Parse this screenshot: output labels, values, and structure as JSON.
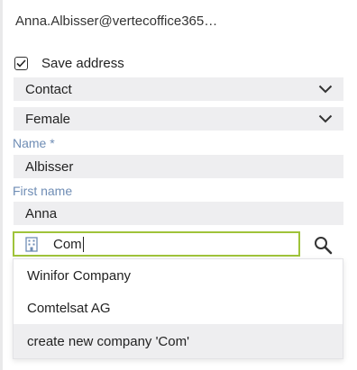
{
  "account": {
    "email": "Anna.Albisser@vertecoffice365…"
  },
  "save_address": {
    "label": "Save address",
    "checked": true
  },
  "type_select": {
    "value": "Contact",
    "icon": "chevron-down-icon"
  },
  "gender_select": {
    "value": "Female",
    "icon": "chevron-down-icon"
  },
  "name_field": {
    "label": "Name *",
    "value": "Albisser"
  },
  "first_name_field": {
    "label": "First name",
    "value": "Anna"
  },
  "company_field": {
    "value": "Com",
    "icon": "building-icon",
    "search_icon": "search-icon",
    "focus_color": "#9fc33a"
  },
  "company_suggestions": {
    "items": [
      "Winifor Company",
      "Comtelsat AG"
    ],
    "create_action": "create new company 'Com'"
  },
  "colors": {
    "field_background": "#eeeef0",
    "label_text": "#6f8db5"
  }
}
